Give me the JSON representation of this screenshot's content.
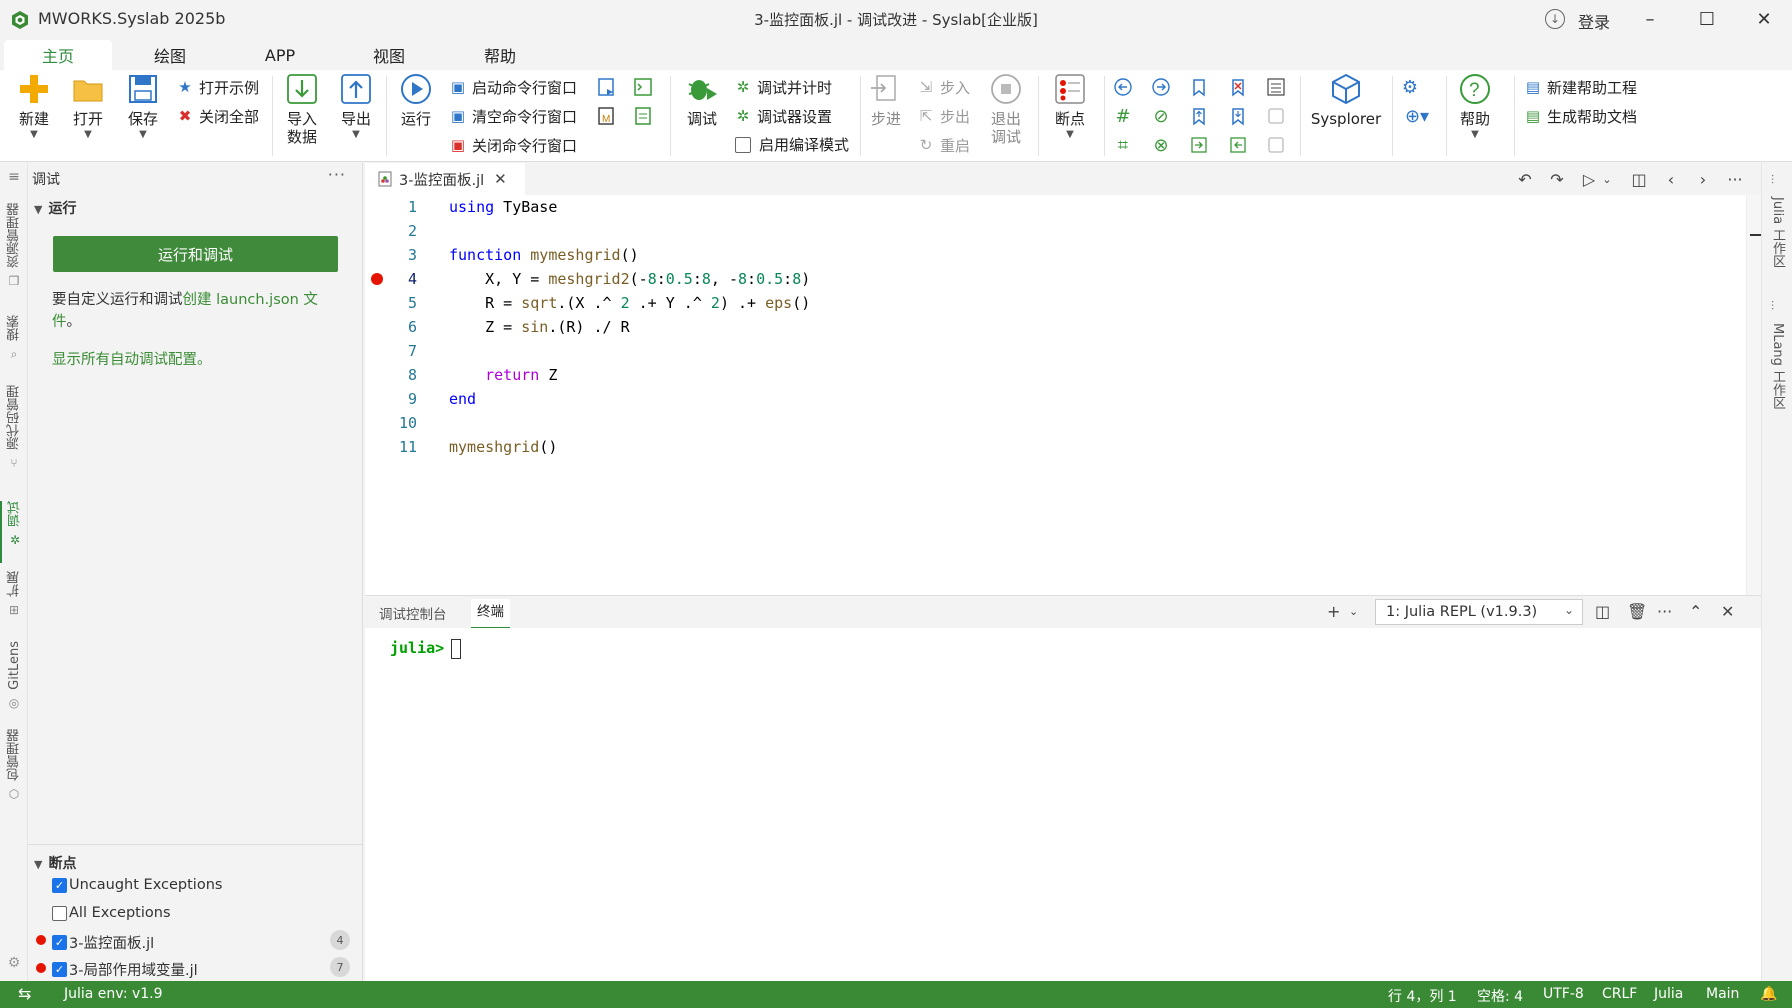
{
  "window": {
    "app_name": "MWORKS.Syslab 2025b",
    "title": "3-监控面板.jl - 调试改进 - Syslab[企业版]",
    "login_label": "登录"
  },
  "menu_tabs": [
    {
      "label": "主页",
      "active": true
    },
    {
      "label": "绘图"
    },
    {
      "label": "APP"
    },
    {
      "label": "视图"
    },
    {
      "label": "帮助"
    }
  ],
  "search": {
    "placeholder": "搜索",
    "value": ""
  },
  "ribbon": {
    "new": "新建",
    "open": "打开",
    "save": "保存",
    "open_example": "打开示例",
    "close_all": "关闭全部",
    "import_data": "导入\n数据",
    "export": "导出",
    "run": "运行",
    "start_cmd": "启动命令行窗口",
    "clear_cmd": "清空命令行窗口",
    "close_cmd": "关闭命令行窗口",
    "debug": "调试",
    "debug_parallel_timer": "调试并计时",
    "debugger_settings": "调试器设置",
    "enable_compile_mode": "启用编译模式",
    "step": "步进",
    "step_in": "步入",
    "step_out": "步出",
    "restart": "重启",
    "exit_debug": "退出\n调试",
    "breakpoint": "断点",
    "sysplorer": "Sysplorer",
    "help": "帮助",
    "new_help_project": "新建帮助工程",
    "gen_help_doc": "生成帮助文档"
  },
  "activity_bar": [
    {
      "label": "资源管理器"
    },
    {
      "label": "搜索"
    },
    {
      "label": "源代码管理"
    },
    {
      "label": "调试",
      "active": true
    },
    {
      "label": "扩展"
    },
    {
      "label": "GitLens"
    },
    {
      "label": "包管理器"
    }
  ],
  "sidebar": {
    "title": "调试",
    "run_section": "运行",
    "run_button": "运行和调试",
    "hint_prefix": "要自定义运行和调试",
    "hint_link": "创建 launch.json 文件",
    "hint_suffix": "。",
    "show_all": "显示所有自动调试配置。",
    "breakpoints_section": "断点",
    "breakpoints": [
      {
        "label": "Uncaught Exceptions",
        "checked": true
      },
      {
        "label": "All Exceptions",
        "checked": false
      },
      {
        "label": "3-监控面板.jl",
        "checked": true,
        "count": "4"
      },
      {
        "label": "3-局部作用域变量.jl",
        "checked": true,
        "count": "7"
      }
    ]
  },
  "editor": {
    "tab": "3-监控面板.jl",
    "lines": [
      {
        "n": "1",
        "text": "using TyBase"
      },
      {
        "n": "2",
        "text": ""
      },
      {
        "n": "3",
        "text": "function mymeshgrid()"
      },
      {
        "n": "4",
        "text": "    X, Y = meshgrid2(-8:0.5:8, -8:0.5:8)"
      },
      {
        "n": "5",
        "text": "    R = sqrt.(X .^ 2 .+ Y .^ 2) .+ eps()"
      },
      {
        "n": "6",
        "text": "    Z = sin.(R) ./ R"
      },
      {
        "n": "7",
        "text": ""
      },
      {
        "n": "8",
        "text": "    return Z"
      },
      {
        "n": "9",
        "text": "end"
      },
      {
        "n": "10",
        "text": ""
      },
      {
        "n": "11",
        "text": "mymeshgrid()"
      }
    ]
  },
  "panel": {
    "tabs": [
      {
        "label": "调试控制台"
      },
      {
        "label": "终端",
        "active": true
      }
    ],
    "repl_select": "1: Julia REPL (v1.9.3)",
    "prompt": "julia>"
  },
  "right_strip": [
    "Julia 工作区",
    "MLang 工作区"
  ],
  "status": {
    "env": "Julia env: v1.9",
    "position": "行 4，列 1",
    "spaces": "空格: 4",
    "encoding": "UTF-8",
    "eol": "CRLF",
    "language": "Julia",
    "module": "Main"
  },
  "colors": {
    "accent": "#2e8b3e",
    "status_bar": "#3a8a35",
    "breakpoint": "#e51400"
  }
}
